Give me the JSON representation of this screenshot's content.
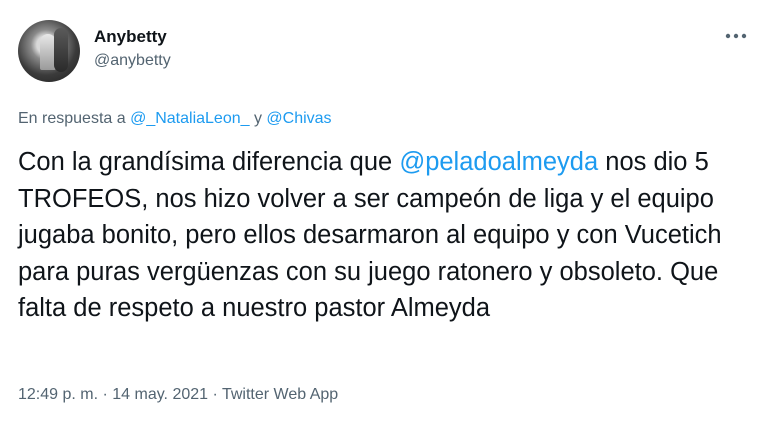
{
  "author": {
    "name": "Anybetty",
    "handle": "@anybetty"
  },
  "reply_context": {
    "prefix": "En respuesta a ",
    "mention1": "@_NataliaLeon_",
    "joiner": " y ",
    "mention2": "@Chivas"
  },
  "tweet": {
    "text_before": "Con la grandísima diferencia que ",
    "mention": "@peladoalmeyda",
    "text_after": " nos dio 5 TROFEOS, nos hizo volver a ser campeón de liga y el equipo jugaba bonito, pero ellos desarmaron al equipo y con Vucetich para puras vergüenzas con su juego ratonero y obsoleto. Que falta de respeto a nuestro pastor Almeyda"
  },
  "meta": {
    "time": "12:49 p. m.",
    "sep1": " · ",
    "date": "14 may. 2021",
    "sep2": " · ",
    "source": "Twitter Web App"
  },
  "icons": {
    "more": "more-horizontal-icon"
  },
  "colors": {
    "link": "#1d9bf0",
    "secondary": "#536471",
    "text": "#0f1419"
  }
}
